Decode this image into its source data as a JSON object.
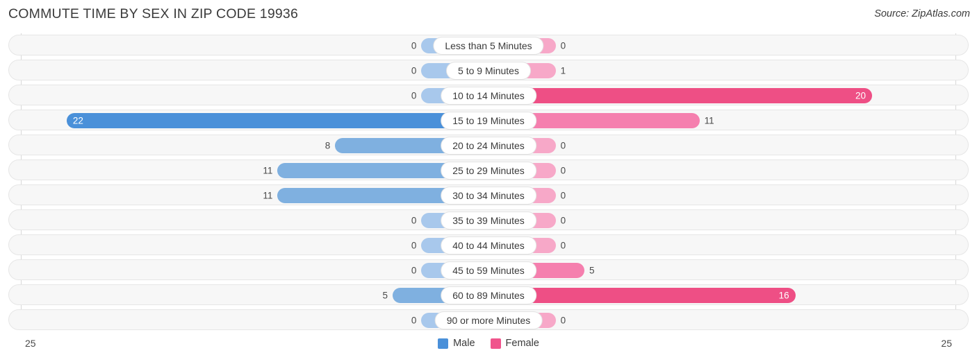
{
  "header": {
    "title": "COMMUTE TIME BY SEX IN ZIP CODE 19936",
    "source": "Source: ZipAtlas.com"
  },
  "axis": {
    "left_label": "25",
    "right_label": "25",
    "max": 25
  },
  "legend": {
    "items": [
      {
        "label": "Male",
        "color": "#4a90d9"
      },
      {
        "label": "Female",
        "color": "#f0548c"
      }
    ]
  },
  "colors": {
    "male_strong": "#4a90d9",
    "male_mid": "#7fb0e0",
    "male_light": "#a8c8ec",
    "female_strong": "#ee4f85",
    "female_mid": "#f57fae",
    "female_light": "#f7a8c8",
    "track": "#f7f7f7",
    "track_border": "#e6e6e6"
  },
  "chart_data": {
    "type": "bar",
    "title": "COMMUTE TIME BY SEX IN ZIP CODE 19936",
    "orientation": "horizontal-diverging",
    "xlabel": "",
    "ylabel": "",
    "xlim": [
      25,
      25
    ],
    "grid": true,
    "legend_position": "bottom-center",
    "categories": [
      "Less than 5 Minutes",
      "5 to 9 Minutes",
      "10 to 14 Minutes",
      "15 to 19 Minutes",
      "20 to 24 Minutes",
      "25 to 29 Minutes",
      "30 to 34 Minutes",
      "35 to 39 Minutes",
      "40 to 44 Minutes",
      "45 to 59 Minutes",
      "60 to 89 Minutes",
      "90 or more Minutes"
    ],
    "series": [
      {
        "name": "Male",
        "values": [
          0,
          0,
          0,
          22,
          8,
          11,
          11,
          0,
          0,
          0,
          5,
          0
        ]
      },
      {
        "name": "Female",
        "values": [
          0,
          1,
          20,
          11,
          0,
          0,
          0,
          0,
          0,
          5,
          16,
          0
        ]
      }
    ]
  },
  "rows": [
    {
      "label": "Less than 5 Minutes",
      "male": "0",
      "female": "0",
      "male_value": 0,
      "female_value": 0
    },
    {
      "label": "5 to 9 Minutes",
      "male": "0",
      "female": "1",
      "male_value": 0,
      "female_value": 1
    },
    {
      "label": "10 to 14 Minutes",
      "male": "0",
      "female": "20",
      "male_value": 0,
      "female_value": 20
    },
    {
      "label": "15 to 19 Minutes",
      "male": "22",
      "female": "11",
      "male_value": 22,
      "female_value": 11
    },
    {
      "label": "20 to 24 Minutes",
      "male": "8",
      "female": "0",
      "male_value": 8,
      "female_value": 0
    },
    {
      "label": "25 to 29 Minutes",
      "male": "11",
      "female": "0",
      "male_value": 11,
      "female_value": 0
    },
    {
      "label": "30 to 34 Minutes",
      "male": "11",
      "female": "0",
      "male_value": 11,
      "female_value": 0
    },
    {
      "label": "35 to 39 Minutes",
      "male": "0",
      "female": "0",
      "male_value": 0,
      "female_value": 0
    },
    {
      "label": "40 to 44 Minutes",
      "male": "0",
      "female": "0",
      "male_value": 0,
      "female_value": 0
    },
    {
      "label": "45 to 59 Minutes",
      "male": "0",
      "female": "5",
      "male_value": 0,
      "female_value": 5
    },
    {
      "label": "60 to 89 Minutes",
      "male": "5",
      "female": "16",
      "male_value": 5,
      "female_value": 16
    },
    {
      "label": "90 or more Minutes",
      "male": "0",
      "female": "0",
      "male_value": 0,
      "female_value": 0
    }
  ]
}
